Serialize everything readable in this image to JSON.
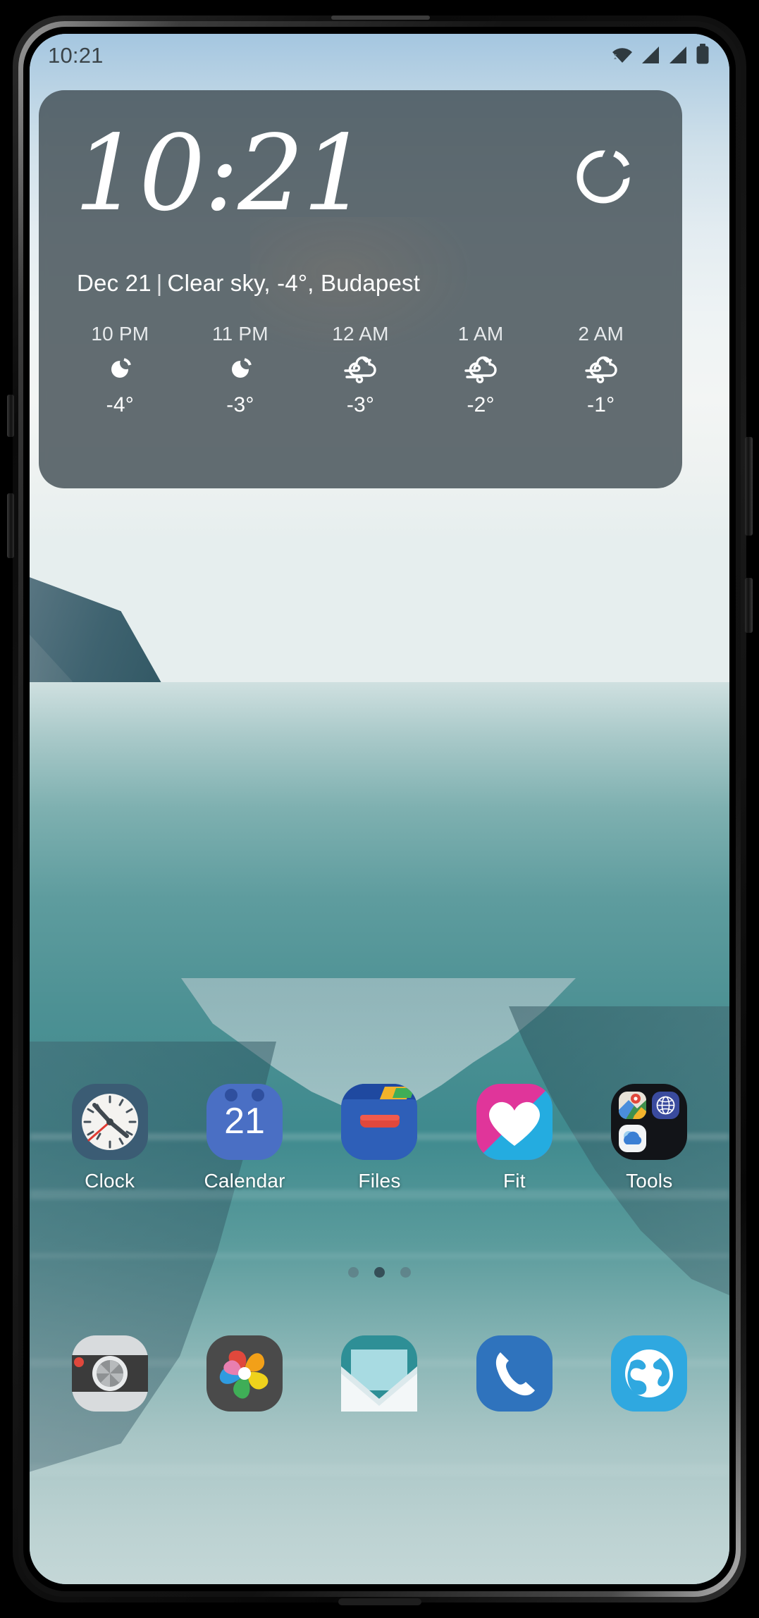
{
  "status_bar": {
    "time": "10:21",
    "icons": [
      {
        "name": "wifi-icon",
        "label": "wifi"
      },
      {
        "name": "signal-sim1-icon",
        "label": "signal"
      },
      {
        "name": "signal-sim2-icon",
        "label": "signal"
      },
      {
        "name": "battery-icon",
        "label": "battery"
      }
    ]
  },
  "widget": {
    "clock": "10:21",
    "moon_icon": "moon-phase-icon",
    "date": "Dec 21",
    "separator": "|",
    "conditions": "Clear sky, -4°, Budapest",
    "summary_line": "Dec 21 | Clear sky, -4°, Budapest",
    "hourly": [
      {
        "time": "10 PM",
        "icon": "moon-clear-icon",
        "temp": "-4°"
      },
      {
        "time": "11 PM",
        "icon": "moon-clear-icon",
        "temp": "-3°"
      },
      {
        "time": "12 AM",
        "icon": "windy-cloud-icon",
        "temp": "-3°"
      },
      {
        "time": "1 AM",
        "icon": "windy-cloud-icon",
        "temp": "-2°"
      },
      {
        "time": "2 AM",
        "icon": "windy-cloud-icon",
        "temp": "-1°"
      }
    ]
  },
  "apps": [
    {
      "label": "Clock",
      "icon": "clock-app-icon"
    },
    {
      "label": "Calendar",
      "icon": "calendar-app-icon",
      "badge": "21"
    },
    {
      "label": "Files",
      "icon": "files-app-icon"
    },
    {
      "label": "Fit",
      "icon": "fit-app-icon"
    },
    {
      "label": "Tools",
      "icon": "tools-folder-icon"
    }
  ],
  "page_indicator": {
    "count": 3,
    "active_index": 1
  },
  "dock": [
    {
      "name": "camera-app-icon",
      "label": "Camera"
    },
    {
      "name": "photos-app-icon",
      "label": "Photos"
    },
    {
      "name": "email-app-icon",
      "label": "Email"
    },
    {
      "name": "phone-app-icon",
      "label": "Phone"
    },
    {
      "name": "browser-app-icon",
      "label": "Browser"
    }
  ],
  "colors": {
    "widget_bg": "#424e54",
    "status_text": "#3a4348",
    "calendar_blue": "#4a6fc4",
    "fit_pink": "#e0359a",
    "fit_cyan": "#24ace0",
    "phone_blue": "#2f73bd",
    "browser_blue": "#2fa8e0",
    "files_blue": "#2e5fb8"
  }
}
